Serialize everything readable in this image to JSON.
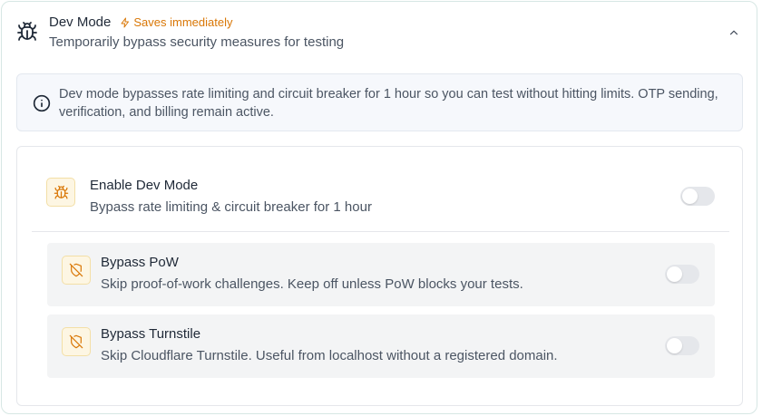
{
  "header": {
    "title": "Dev Mode",
    "saves_label": "Saves immediately",
    "subtitle": "Temporarily bypass security measures for testing",
    "icon": "bug-icon",
    "collapse_icon": "chevron-up-icon"
  },
  "info": {
    "icon": "info-icon",
    "text": "Dev mode bypasses rate limiting and circuit breaker for 1 hour so you can test without hitting limits. OTP sending, verification, and billing remain active."
  },
  "main_setting": {
    "icon": "bug-icon",
    "label": "Enable Dev Mode",
    "description": "Bypass rate limiting & circuit breaker for 1 hour",
    "enabled": false
  },
  "sub_settings": [
    {
      "icon": "shield-off-icon",
      "label": "Bypass PoW",
      "description": "Skip proof-of-work challenges. Keep off unless PoW blocks your tests.",
      "enabled": false
    },
    {
      "icon": "shield-off-icon",
      "label": "Bypass Turnstile",
      "description": "Skip Cloudflare Turnstile. Useful from localhost without a registered domain.",
      "enabled": false
    }
  ],
  "colors": {
    "accent": "#d97706",
    "icon_bg": "#fdf6e3",
    "toggle_off": "#e5e7eb"
  }
}
